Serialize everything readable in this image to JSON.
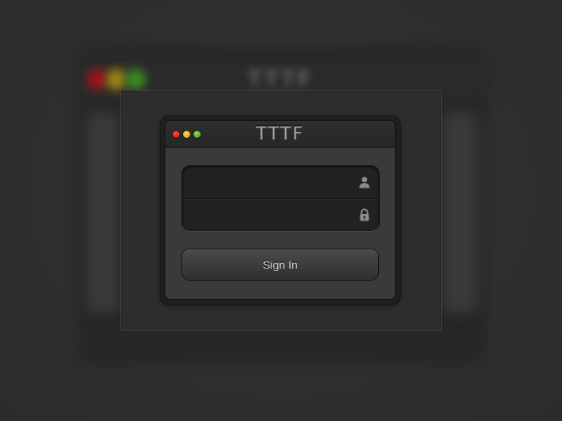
{
  "window": {
    "title": "TTTF",
    "controls": [
      {
        "name": "close",
        "color": "#c0151a"
      },
      {
        "name": "minimize",
        "color": "#e3a911"
      },
      {
        "name": "zoom",
        "color": "#53a524"
      }
    ]
  },
  "form": {
    "username": {
      "value": "",
      "placeholder": "",
      "icon": "user-icon"
    },
    "password": {
      "value": "",
      "placeholder": "",
      "icon": "lock-icon"
    },
    "submit_label": "Sign In"
  },
  "background": {
    "ghost_title": "TTTF"
  }
}
